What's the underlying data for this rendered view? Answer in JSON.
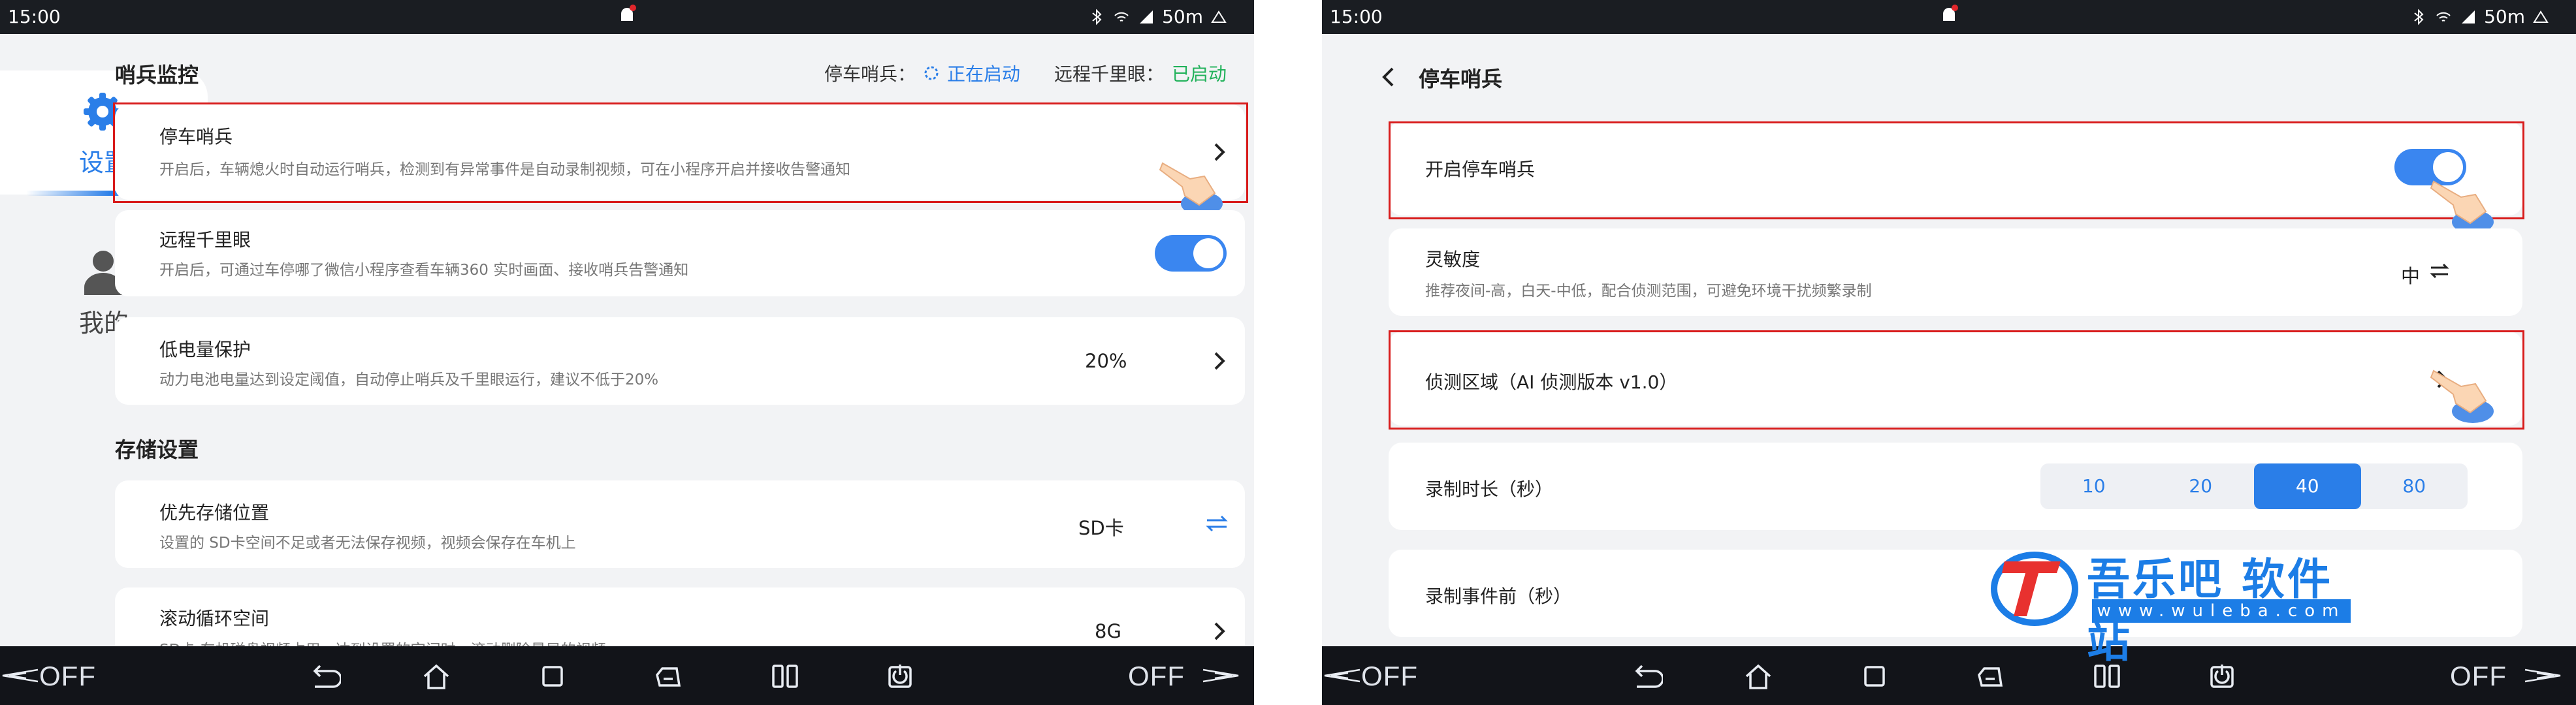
{
  "status_bar": {
    "time": "15:00",
    "right_text": "50m"
  },
  "nav_bar": {
    "left_label": "OFF",
    "right_label": "OFF"
  },
  "left_screen": {
    "sidebar": {
      "settings_label": "设置",
      "me_label": "我的"
    },
    "section1": {
      "title": "哨兵监控",
      "parking_status_label": "停车哨兵：",
      "parking_status_value": "正在启动",
      "remote_status_label": "远程千里眼：",
      "remote_status_value": "已启动"
    },
    "items": [
      {
        "title": "停车哨兵",
        "subtitle": "开启后，车辆熄火时自动运行哨兵，检测到有异常事件是自动录制视频，可在小程序开启并接收告警通知"
      },
      {
        "title": "远程千里眼",
        "subtitle": "开启后，可通过车停哪了微信小程序查看车辆360 实时画面、接收哨兵告警通知",
        "toggle": true
      },
      {
        "title": "低电量保护",
        "subtitle": "动力电池电量达到设定阈值，自动停止哨兵及千里眼运行，建议不低于20%",
        "value": "20%"
      }
    ],
    "section2": {
      "title": "存储设置"
    },
    "storage_items": [
      {
        "title": "优先存储位置",
        "subtitle": "设置的 SD卡空间不足或者无法保存视频，视频会保存在车机上",
        "value": "SD卡"
      },
      {
        "title": "滚动循环空间",
        "subtitle": "SD卡 车机磁盘视频占用，达到设置的空间时，滚动删除最早的视频",
        "value": "8G"
      }
    ]
  },
  "right_screen": {
    "header": {
      "title": "停车哨兵"
    },
    "enable": {
      "label": "开启停车哨兵",
      "toggle": true
    },
    "sensitivity": {
      "title": "灵敏度",
      "subtitle": "推荐夜间-高，白天-中低，配合侦测范围，可避免环境干扰频繁录制",
      "value": "中"
    },
    "detect_area": {
      "title": "侦测区域（AI 侦测版本 v1.0）"
    },
    "duration": {
      "title": "录制时长（秒）",
      "options": [
        "10",
        "20",
        "40",
        "80"
      ],
      "selected": "40"
    },
    "pre_event": {
      "title": "录制事件前（秒）"
    }
  },
  "watermark": {
    "brand": "吾乐吧 软件站",
    "url": "www.wuleba.com"
  },
  "colors": {
    "accent": "#2a7ee8",
    "green": "#22b25b",
    "red_box": "#d81b1b",
    "toggle": "#3a86f0"
  },
  "icons": [
    "gear-icon",
    "person-icon",
    "chevron-right-icon",
    "swap-icon",
    "back-arrow-icon",
    "pointing-hand-icon",
    "home-icon",
    "back-icon",
    "recent-icon",
    "split-icon",
    "power-icon",
    "vehicle-icon",
    "bell-icon"
  ]
}
